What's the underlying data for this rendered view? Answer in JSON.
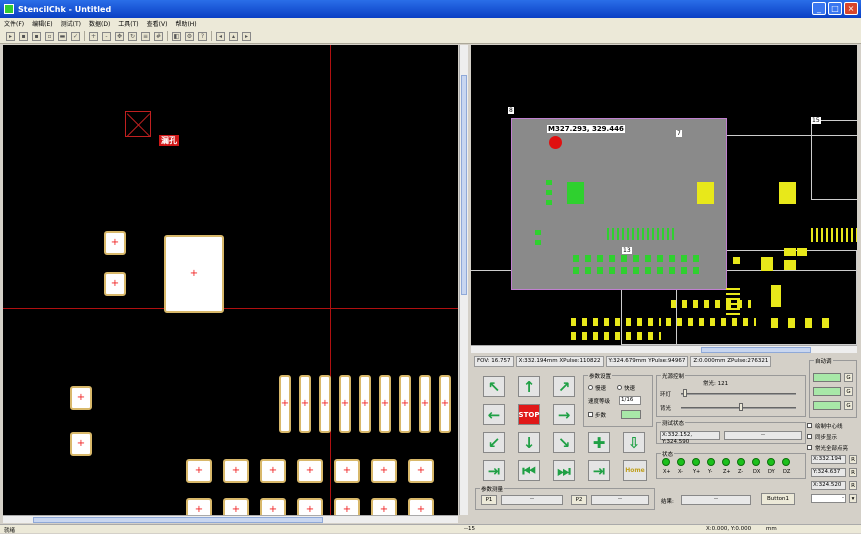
{
  "window": {
    "title": "StencilChk - Untitled",
    "minimize": "_",
    "maximize": "□",
    "close": "×"
  },
  "menu": [
    "文件(F)",
    "编辑(E)",
    "测试(T)",
    "数据(D)",
    "工具(T)",
    "查看(V)",
    "帮助(H)"
  ],
  "toolbar_icons": [
    "open-icon",
    "save-icon",
    "save-as-icon",
    "print-icon",
    "measure-icon",
    "check-icon",
    "zoom-in-icon",
    "zoom-out-icon",
    "pan-icon",
    "rotate-icon",
    "align-icon",
    "grid-icon",
    "layer-icon",
    "settings-icon",
    "help-icon",
    "nav-icon",
    "nav2-icon",
    "nav3-icon"
  ],
  "left_view": {
    "hole_label": "漏孔"
  },
  "right_view": {
    "coordinate": "M327.293, 329.446",
    "tags": [
      "8",
      "7",
      "15",
      "13"
    ]
  },
  "status_fields": [
    "FOV: 16.757",
    "X:332.194mm  XPulse:110822",
    "Y:324.679mm  YPulse:94967",
    "Z:0.000mm  ZPulse:276321"
  ],
  "motion": {
    "params_title": "参数设置",
    "slow_label": "慢速",
    "fast_label": "快速",
    "speed_label": "速度等级",
    "speed_value": "1/16",
    "step_label": "步数",
    "step_value": "0",
    "stop_label": "STOP",
    "ref_group_title": "参数测量",
    "p1_label": "P1",
    "p1_value": "--",
    "p2_label": "P2",
    "p2_value": "--",
    "home_label": "Home"
  },
  "light": {
    "title": "光源控制",
    "ring_label": "环灯",
    "ring_value": "常光: 121",
    "coax_label": "同灯",
    "coax_value": "121",
    "lamp_label": "同灯",
    "light_label": "背光"
  },
  "test_state": {
    "title": "测试状态",
    "position": "X:332.152, Y:324.590",
    "position2": "--"
  },
  "status_group": {
    "title": "状态",
    "leds": [
      "X+",
      "X-",
      "Y+",
      "Y-",
      "Z+",
      "Z-",
      "DX",
      "DY",
      "DZ"
    ]
  },
  "result": {
    "label": "结果:",
    "value": "--",
    "button": "Button1"
  },
  "focus": {
    "title": "自动调",
    "buttons": [
      "G",
      "G",
      "G"
    ],
    "options": [
      "绘制中心线",
      "同步显示",
      "常光全部点亮"
    ],
    "readouts": [
      "X:332.194",
      "Y:324.637",
      "X:324.520"
    ],
    "readout_buttons": [
      "R",
      "R",
      "R"
    ],
    "dropdown_value": "-"
  },
  "statusbar": {
    "ready": "就绪",
    "coords": "X:0.000, Y:0.000",
    "unit": "mm",
    "scale": "--15"
  }
}
